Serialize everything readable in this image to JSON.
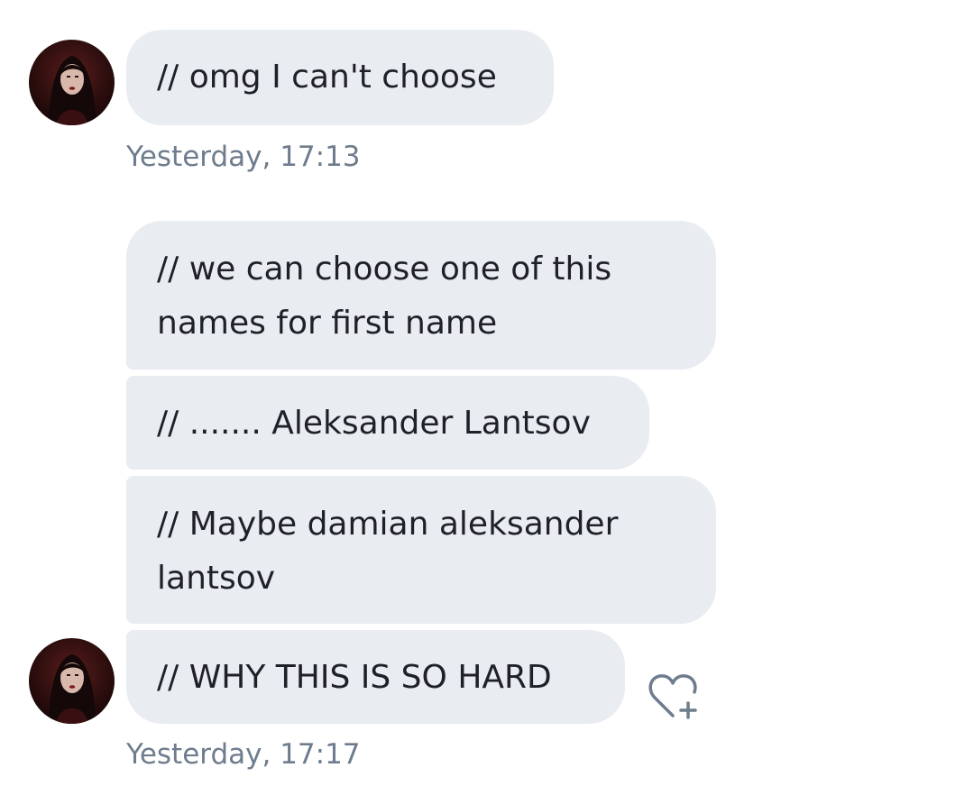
{
  "conversation": {
    "groups": [
      {
        "messages": [
          {
            "text": "// omg I can't choose"
          }
        ],
        "timestamp": "Yesterday, 17:13"
      },
      {
        "messages": [
          {
            "text": "// we can choose one of this names for first name"
          },
          {
            "text": "// ....... Aleksander Lantsov"
          },
          {
            "text": "// Maybe damian aleksander lantsov"
          },
          {
            "text": "// WHY THIS IS SO HARD"
          }
        ],
        "timestamp": "Yesterday, 17:17"
      }
    ]
  },
  "icons": {
    "avatar": "avatar",
    "like": "heart-plus-icon"
  },
  "colors": {
    "bubble_bg": "#e9ecf0",
    "timestamp": "#6e7c8d",
    "text": "#1f2128"
  }
}
